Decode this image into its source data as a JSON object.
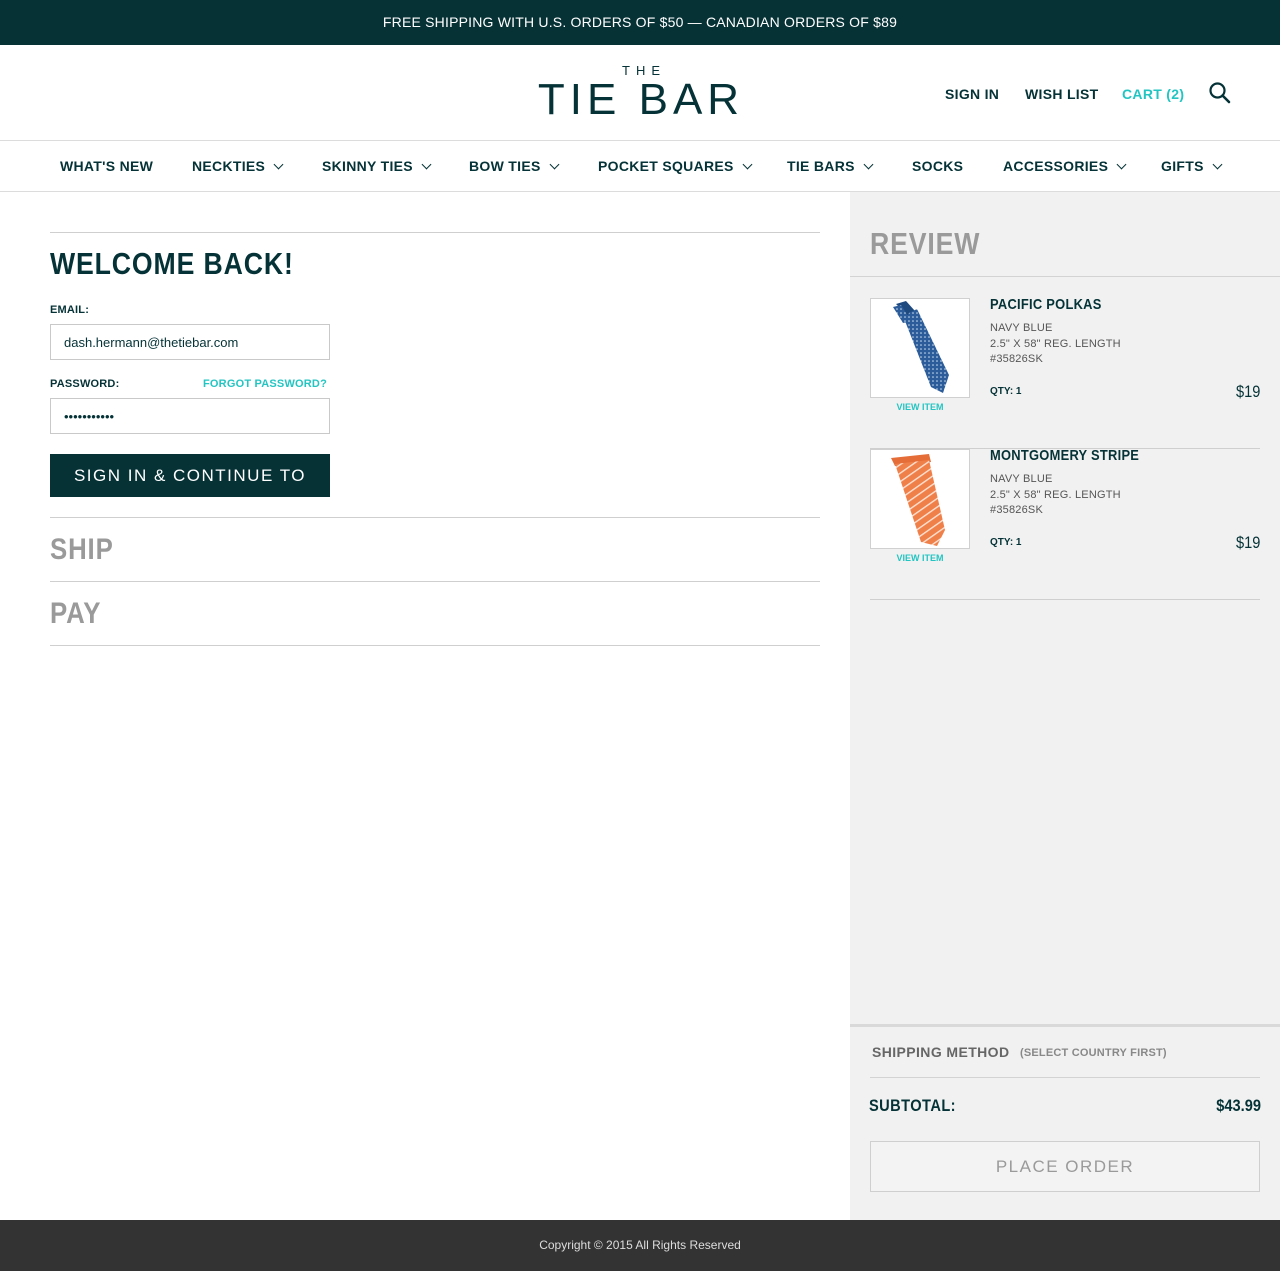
{
  "promo": {
    "text": "FREE SHIPPING WITH U.S. ORDERS OF $50 — CANADIAN ORDERS OF $89"
  },
  "header": {
    "logo_small": "THE",
    "logo_main": "TIE BAR",
    "sign_in": "SIGN IN",
    "wish_list": "WISH LIST",
    "cart": "CART (2)",
    "search_icon": "search-icon"
  },
  "nav": {
    "items": [
      {
        "label": "WHAT'S NEW",
        "dropdown": false
      },
      {
        "label": "NECKTIES",
        "dropdown": true
      },
      {
        "label": "SKINNY TIES",
        "dropdown": true
      },
      {
        "label": "BOW TIES",
        "dropdown": true
      },
      {
        "label": "POCKET SQUARES",
        "dropdown": true
      },
      {
        "label": "TIE BARS",
        "dropdown": true
      },
      {
        "label": "SOCKS",
        "dropdown": false
      },
      {
        "label": "ACCESSORIES",
        "dropdown": true
      },
      {
        "label": "GIFTS",
        "dropdown": true
      }
    ]
  },
  "signin": {
    "title": "WELCOME BACK!",
    "email_label": "EMAIL:",
    "email_value": "dash.hermann@thetiebar.com",
    "password_label": "PASSWORD:",
    "forgot": "FORGOT PASSWORD?",
    "password_value": "•••••••••••",
    "button": "SIGN IN & CONTINUE TO SHIP >"
  },
  "steps": {
    "ship": "SHIP",
    "pay": "PAY"
  },
  "review": {
    "title": "REVIEW",
    "items": [
      {
        "name": "PACIFIC POLKAS",
        "color": "NAVY BLUE",
        "size": "2.5\" X 58\" REG. LENGTH",
        "sku": "#35826SK",
        "qty": "QTY: 1",
        "price": "$19",
        "view": "VIEW ITEM",
        "tie_color": "#2c5d9a"
      },
      {
        "name": "MONTGOMERY STRIPE",
        "color": "NAVY BLUE",
        "size": "2.5\" X 58\" REG. LENGTH",
        "sku": "#35826SK",
        "qty": "QTY: 1",
        "price": "$19",
        "view": "VIEW ITEM",
        "tie_color": "#f0804a"
      }
    ],
    "shipping_method": "SHIPPING METHOD",
    "shipping_note": "(SELECT COUNTRY FIRST)",
    "subtotal_label": "SUBTOTAL:",
    "subtotal_value": "$43.99",
    "place_order": "PLACE ORDER"
  },
  "footer": {
    "text": "Copyright © 2015 All Rights Reserved"
  },
  "colors": {
    "brand": "#063236",
    "accent": "#22c5c2",
    "muted": "#9a9a9a"
  }
}
